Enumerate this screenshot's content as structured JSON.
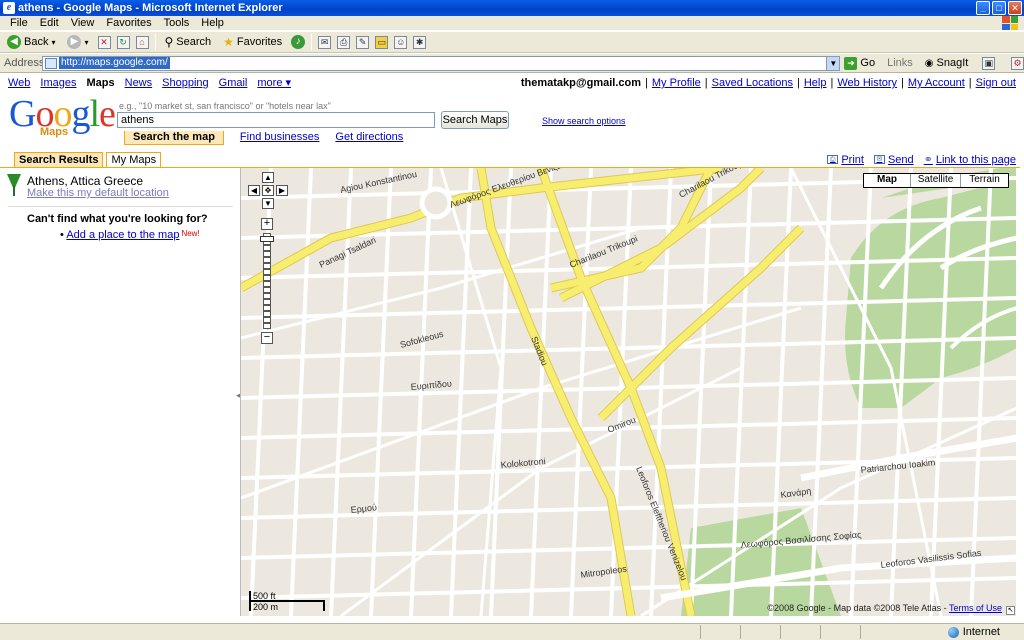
{
  "window": {
    "title": "athens - Google Maps - Microsoft Internet Explorer",
    "app_icon": "e",
    "menu": [
      "File",
      "Edit",
      "View",
      "Favorites",
      "Tools",
      "Help"
    ]
  },
  "toolbar": {
    "back": "Back",
    "search": "Search",
    "favorites": "Favorites"
  },
  "address": {
    "label": "Address",
    "url": "http://maps.google.com/",
    "go": "Go",
    "links": "Links",
    "snagit": "SnagIt"
  },
  "gbar": {
    "links": [
      "Web",
      "Images",
      "Maps",
      "News",
      "Shopping",
      "Gmail",
      "more ▾"
    ],
    "active": "Maps",
    "account": "thematakp@gmail.com",
    "right_links": [
      "My Profile",
      "Saved Locations",
      "Help",
      "Web History",
      "My Account",
      "Sign out"
    ]
  },
  "logo": {
    "letters": [
      "G",
      "o",
      "o",
      "g",
      "l",
      "e"
    ],
    "sub": "Maps"
  },
  "search": {
    "hint": "e.g., \"10 market st, san francisco\" or \"hotels near lax\"",
    "value": "athens",
    "button": "Search Maps",
    "show_options": "Show search options",
    "modes": {
      "search_map": "Search the map",
      "find_businesses": "Find businesses",
      "get_directions": "Get directions"
    }
  },
  "side_tabs": {
    "results": "Search Results",
    "my_maps": "My Maps"
  },
  "map_links": {
    "print": "Print",
    "send": "Send",
    "link": "Link to this page"
  },
  "result": {
    "title": "Athens, Attica Greece",
    "default_link": "Make this my default location",
    "cant_find": "Can't find what you're looking for?",
    "add_place": "Add a place to the map",
    "new_badge": "New!"
  },
  "map_type": [
    "Map",
    "Satellite",
    "Terrain"
  ],
  "map_labels": {
    "agiou": "Agiou Konstantinou",
    "panagi": "Panagi Tsaldari",
    "charilaou_top": "Charilaou Trikoupi",
    "charilaou": "Charilaou Trikoupi",
    "leof_eleftheriou": "Λεωφόρος Ελευθερίου Βενιζέλου",
    "leof_vasilissis": "Λεωφόρος Βασιλίσσης Σοφίας",
    "leof_vasilissis_en": "Leoforos Vasilissis Sofias",
    "patriarchou": "Patriarchou Ioakim",
    "leof_venizelou": "Leoforos Eleftheriou Venizelou",
    "stadiou": "Stadiou",
    "sofokleous": "Sofokleous",
    "omirou": "Omirou",
    "mitropoleos": "Mitropoleos",
    "kolokotroni": "Kolokotroni",
    "evripidou": "Ευριπίδου",
    "kanari": "Κανάρη",
    "ermou": "Ερμού"
  },
  "scale": {
    "ft": "500 ft",
    "m": "200 m"
  },
  "copyright": {
    "text": "©2008 Google - Map data ©2008 Tele Atlas -",
    "terms": "Terms of Use"
  },
  "status": {
    "zone": "Internet"
  },
  "colors": {
    "highway": "#f7ee70",
    "road": "#ffffff",
    "park": "#b8d8a0",
    "land": "#ece8df",
    "tab_accent": "#f0a818"
  }
}
